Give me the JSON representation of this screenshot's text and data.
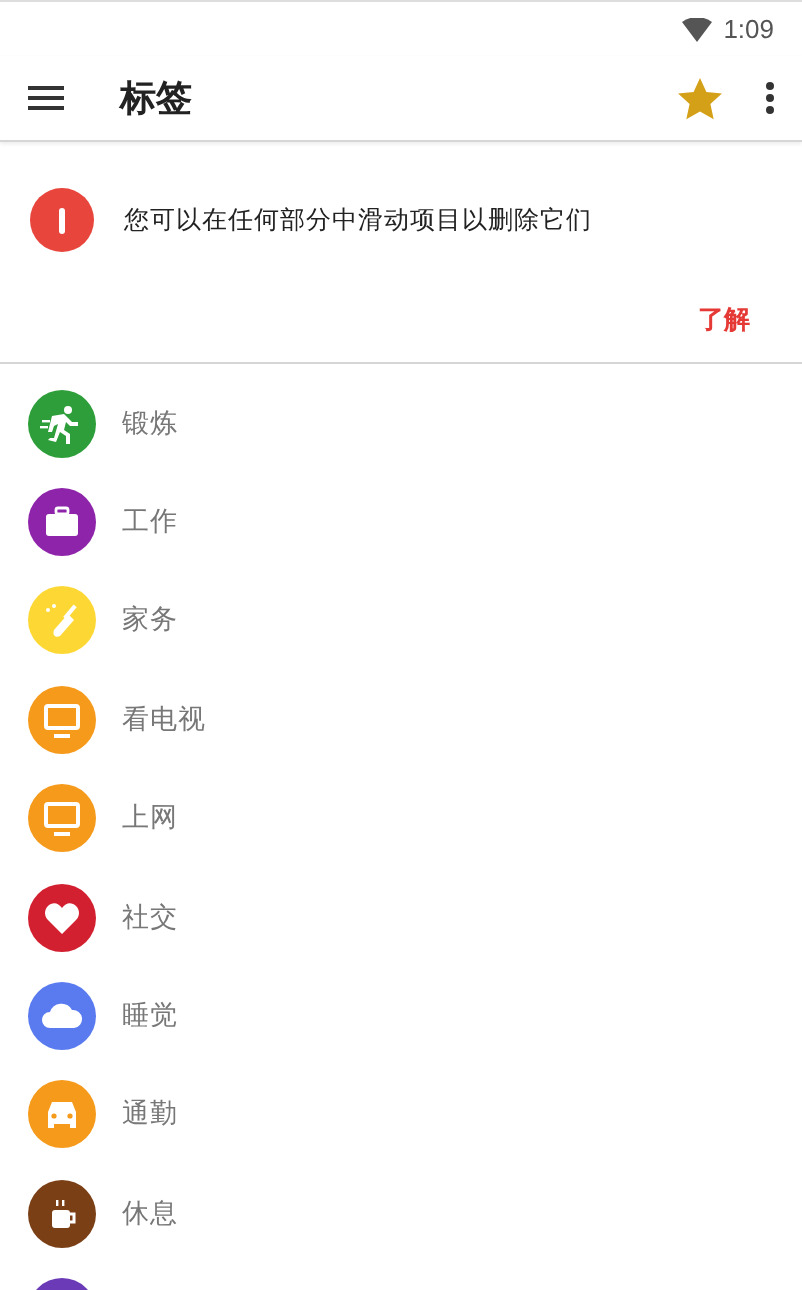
{
  "status_bar": {
    "time": "1:09"
  },
  "toolbar": {
    "title": "标签"
  },
  "banner": {
    "message": "您可以在任何部分中滑动项目以删除它们",
    "action": "了解"
  },
  "tags": [
    {
      "label": "锻炼",
      "color": "#2e9e3a",
      "kind": "run"
    },
    {
      "label": "工作",
      "color": "#8e24aa",
      "kind": "briefcase"
    },
    {
      "label": "家务",
      "color": "#fdd835",
      "kind": "broom"
    },
    {
      "label": "看电视",
      "color": "#f59a1b",
      "kind": "monitor"
    },
    {
      "label": "上网",
      "color": "#f59a1b",
      "kind": "monitor"
    },
    {
      "label": "社交",
      "color": "#d32030",
      "kind": "heart"
    },
    {
      "label": "睡觉",
      "color": "#5a7bf0",
      "kind": "cloud"
    },
    {
      "label": "通勤",
      "color": "#f59a1b",
      "kind": "car"
    },
    {
      "label": "休息",
      "color": "#7b3f16",
      "kind": "cup"
    },
    {
      "color": "#6a3ab7",
      "kind": "blank"
    }
  ]
}
